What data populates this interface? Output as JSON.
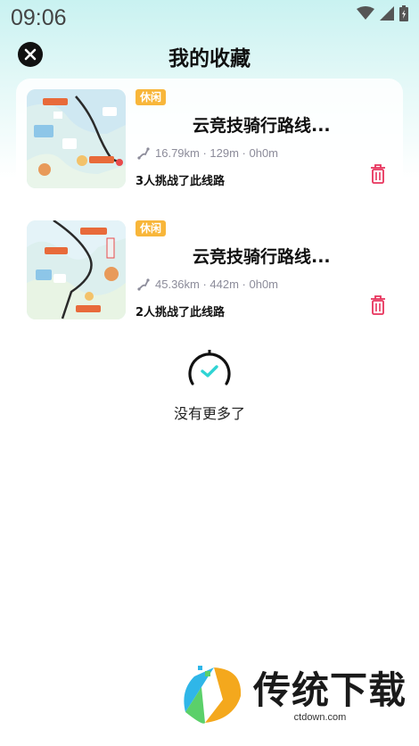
{
  "status_bar": {
    "time": "09:06"
  },
  "header": {
    "title": "我的收藏"
  },
  "routes": [
    {
      "tag": "休闲",
      "title": "云竞技骑行路线...",
      "stats": "16.79km · 129m · 0h0m",
      "challenge": "3人挑战了此线路"
    },
    {
      "tag": "休闲",
      "title": "云竞技骑行路线...",
      "stats": "45.36km · 442m · 0h0m",
      "challenge": "2人挑战了此线路"
    }
  ],
  "list_end": {
    "text": "没有更多了"
  },
  "watermark": {
    "brand": "传统下载",
    "url": "ctdown.com"
  },
  "colors": {
    "tag": "#f8b63a",
    "delete": "#e8335c",
    "accent": "#2fd4d4"
  }
}
